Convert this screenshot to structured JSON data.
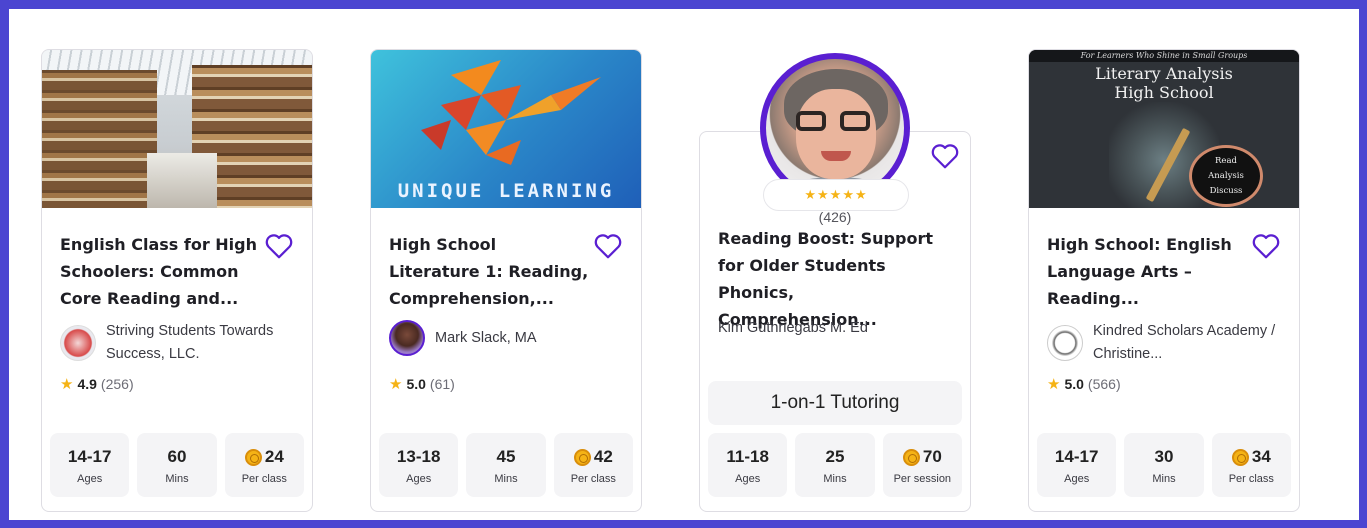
{
  "cards": [
    {
      "title": "English Class for High Schoolers: Common Core Reading and...",
      "author": "Striving Students Towards Success, LLC.",
      "rating": "4.9",
      "rating_count": "(256)",
      "stats": [
        {
          "value": "14-17",
          "label": "Ages"
        },
        {
          "value": "60",
          "label": "Mins"
        },
        {
          "value": "24",
          "label": "Per class"
        }
      ]
    },
    {
      "title": "High School Literature 1: Reading, Comprehension,...",
      "author": "Mark Slack, MA",
      "rating": "5.0",
      "rating_count": "(61)",
      "image_text": "UNIQUE LEARNING",
      "stats": [
        {
          "value": "13-18",
          "label": "Ages"
        },
        {
          "value": "45",
          "label": "Mins"
        },
        {
          "value": "42",
          "label": "Per class"
        }
      ]
    },
    {
      "title": "Reading Boost: Support for Older Students Phonics, Comprehension...",
      "author": "Kim Guthriegabs M. Ed",
      "stars": "★★★★★",
      "rating_count": "(426)",
      "format": "1-on-1 Tutoring",
      "stats": [
        {
          "value": "11-18",
          "label": "Ages"
        },
        {
          "value": "25",
          "label": "Mins"
        },
        {
          "value": "70",
          "label": "Per session"
        }
      ]
    },
    {
      "title": "High School: English Language Arts – Reading...",
      "author": "Kindred Scholars Academy / Christine...",
      "rating": "5.0",
      "rating_count": "(566)",
      "image_text": {
        "banner": "For Learners Who Shine in Small Groups",
        "line1": "Literary Analysis",
        "line2": "High School",
        "badge1": "Read",
        "badge2": "Analysis",
        "badge3": "Discuss"
      },
      "stats": [
        {
          "value": "14-17",
          "label": "Ages"
        },
        {
          "value": "30",
          "label": "Mins"
        },
        {
          "value": "34",
          "label": "Per class"
        }
      ]
    }
  ],
  "colors": {
    "frame": "#4b45d1",
    "heart": "#5a1fd1",
    "star": "#f5b316"
  },
  "icons": {
    "favorite": "heart-outline-icon",
    "rating": "star-icon",
    "price": "coin-icon"
  }
}
